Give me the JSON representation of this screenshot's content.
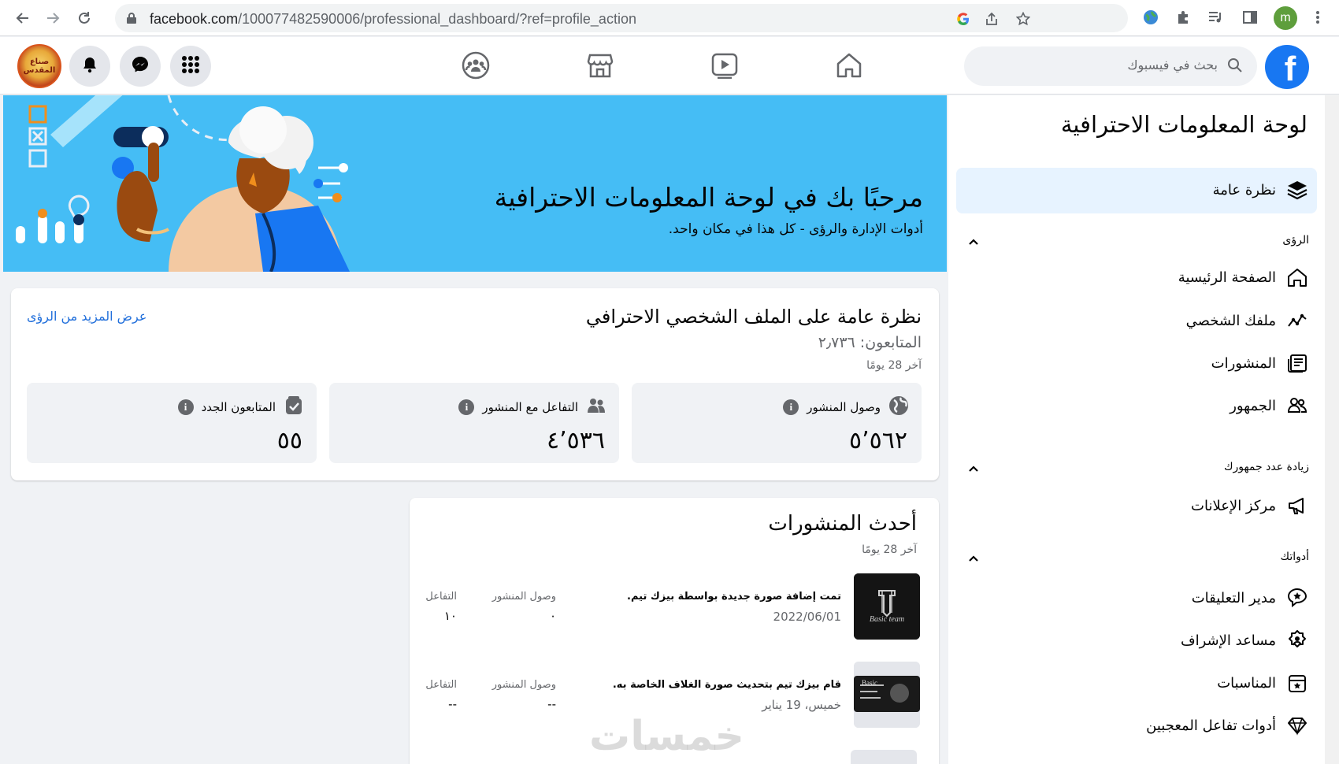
{
  "browser": {
    "url_host": "facebook.com",
    "url_path": "/100077482590006/professional_dashboard/?ref=profile_action",
    "profile_initial": "m"
  },
  "fb": {
    "search_placeholder": "بحث في فيسبوك",
    "logo_letter": "f",
    "avatar_text": "صناع المقدس"
  },
  "sidebar": {
    "title": "لوحة المعلومات الاحترافية",
    "overview": "نظرة عامة",
    "section_insights": "الرؤى",
    "home": "الصفحة الرئيسية",
    "profile": "ملفك الشخصي",
    "posts": "المنشورات",
    "audience": "الجمهور",
    "section_grow": "زيادة عدد جمهورك",
    "ads_center": "مركز الإعلانات",
    "section_tools": "أدواتك",
    "comment_manager": "مدير التعليقات",
    "moderation_assist": "مساعد الإشراف",
    "events": "المناسبات",
    "fan_tools": "أدوات تفاعل المعجبين"
  },
  "banner": {
    "title": "مرحبًا بك في لوحة المعلومات الاحترافية",
    "subtitle": "أدوات الإدارة والرؤى - كل هذا في مكان واحد."
  },
  "overview_card": {
    "title": "نظرة عامة على الملف الشخصي الاحترافي",
    "followers": "المتابعون: ٢٫٧٣٦",
    "period": "آخر 28 يومًا",
    "more_link": "عرض المزيد من الرؤى",
    "metrics": [
      {
        "label": "وصول المنشور",
        "value": "٥٬٥٦٢"
      },
      {
        "label": "التفاعل مع المنشور",
        "value": "٤٬٥٣٦"
      },
      {
        "label": "المتابعون الجدد",
        "value": "٥٥"
      }
    ]
  },
  "latest_posts": {
    "title": "أحدث المنشورات",
    "period": "آخر 28 يومًا",
    "reach_label": "وصول المنشور",
    "engagement_label": "التفاعل",
    "posts": [
      {
        "text": "تمت إضافة صورة جديدة بواسطة بيزك تيم.",
        "date": "2022/06/01",
        "reach": "٠",
        "engagement": "١٠",
        "thumb_text": "Basic team"
      },
      {
        "text": "قام بيزك تيم بتحديث صورة الغلاف الخاصة به.",
        "date": "خميس، 19 يناير",
        "reach": "--",
        "engagement": "--",
        "thumb_text": "Basic"
      }
    ]
  },
  "watermark": "خمسات"
}
